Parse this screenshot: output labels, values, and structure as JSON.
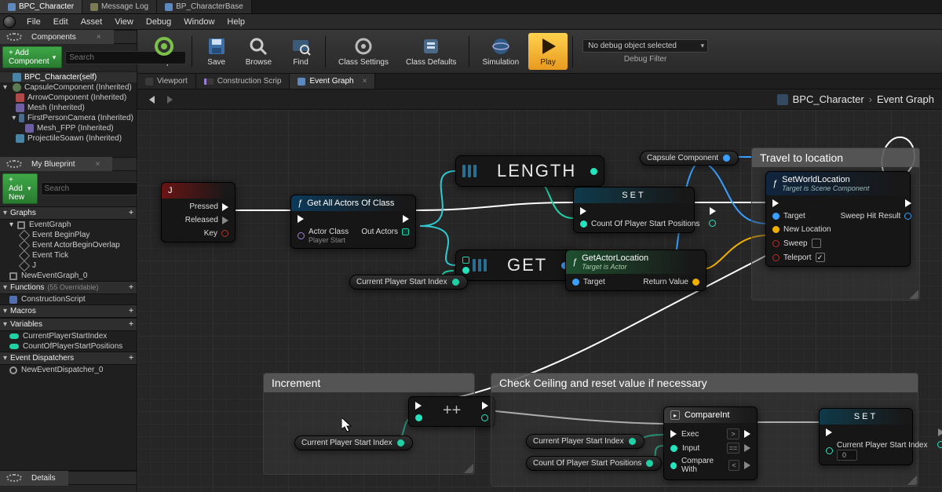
{
  "titleTabs": [
    "BPC_Character",
    "Message Log",
    "BP_CharacterBase"
  ],
  "activeTitleTab": 0,
  "menu": [
    "File",
    "Edit",
    "Asset",
    "View",
    "Debug",
    "Window",
    "Help"
  ],
  "componentsPanel": {
    "title": "Components",
    "addButton": "+ Add Component",
    "searchPlaceholder": "Search",
    "items": [
      {
        "label": "BPC_Character(self)",
        "indent": 0,
        "icon": "class",
        "sel": true
      },
      {
        "label": "CapsuleComponent (Inherited)",
        "indent": 0,
        "tri": "▾",
        "icon": "pill"
      },
      {
        "label": "ArrowComponent (Inherited)",
        "indent": 1,
        "icon": "arrow"
      },
      {
        "label": "Mesh (Inherited)",
        "indent": 1,
        "icon": "mesh"
      },
      {
        "label": "FirstPersonCamera (Inherited)",
        "indent": 1,
        "tri": "▾",
        "icon": "cam"
      },
      {
        "label": "Mesh_FPP (Inherited)",
        "indent": 2,
        "icon": "mesh"
      },
      {
        "label": "ProjectileSoawn (Inherited)",
        "indent": 1,
        "icon": "class"
      }
    ]
  },
  "myBlueprint": {
    "title": "My Blueprint",
    "addButton": "+ Add New",
    "searchPlaceholder": "Search",
    "sections": {
      "graphs": {
        "title": "Graphs",
        "items": [
          {
            "label": "EventGraph",
            "type": "graph",
            "tri": "▾"
          },
          {
            "label": "Event BeginPlay",
            "type": "event"
          },
          {
            "label": "Event ActorBeginOverlap",
            "type": "event"
          },
          {
            "label": "Event Tick",
            "type": "event"
          },
          {
            "label": "J",
            "type": "event"
          },
          {
            "label": "NewEventGraph_0",
            "type": "graph"
          }
        ]
      },
      "functions": {
        "title": "Functions",
        "ov": "(55 Overridable)",
        "items": [
          {
            "label": "ConstructionScript",
            "type": "fn"
          }
        ]
      },
      "macros": {
        "title": "Macros",
        "items": []
      },
      "variables": {
        "title": "Variables",
        "items": [
          {
            "label": "CurrentPlayerStartIndex",
            "type": "var"
          },
          {
            "label": "CountOfPlayerStartPositions",
            "type": "var"
          }
        ]
      },
      "dispatchers": {
        "title": "Event Dispatchers",
        "items": [
          {
            "label": "NewEventDispatcher_0",
            "type": "disp"
          }
        ]
      }
    }
  },
  "detailsTab": "Details",
  "toolbar": {
    "buttons": [
      "Compile",
      "Save",
      "Browse",
      "Find",
      "Class Settings",
      "Class Defaults",
      "Simulation",
      "Play"
    ],
    "debugSelect": "No debug object selected",
    "debugLabel": "Debug Filter"
  },
  "graphTabs": [
    "Viewport",
    "Construction Scrip",
    "Event Graph"
  ],
  "activeGraphTab": 2,
  "breadcrumb": [
    "BPC_Character",
    "Event Graph"
  ],
  "nodes": {
    "eventJ": {
      "title": "J",
      "pins": [
        "Pressed",
        "Released",
        "Key"
      ]
    },
    "getAllActors": {
      "title": "Get All Actors Of Class",
      "actorClass": "Actor Class",
      "actorClassVal": "Player Start",
      "outActors": "Out Actors"
    },
    "length": "LENGTH",
    "get": "GET",
    "setCount": {
      "label": "SET",
      "pin": "Count Of Player Start Positions"
    },
    "getActorLoc": {
      "title": "GetActorLocation",
      "sub": "Target is Actor",
      "target": "Target",
      "ret": "Return Value"
    },
    "capsule": "Capsule Component",
    "varCurrentIndex": "Current Player Start Index",
    "varCount": "Count Of Player Start Positions",
    "travelComment": "Travel to location",
    "setWorld": {
      "title": "SetWorldLocation",
      "sub": "Target is Scene Component",
      "target": "Target",
      "newLoc": "New Location",
      "sweep": "Sweep",
      "teleport": "Teleport",
      "sweepHit": "Sweep Hit Result",
      "teleportChecked": true
    },
    "incComment": "Increment",
    "incSym": "++",
    "checkComment": "Check Ceiling and reset value if necessary",
    "compare": {
      "title": "CompareInt",
      "exec": "Exec",
      "input": "Input",
      "compare": "Compare With",
      "gt": ">",
      "eq": "==",
      "lt": "<"
    },
    "setIndex": {
      "label": "SET",
      "pin": "Current Player Start Index",
      "val": "0"
    }
  }
}
